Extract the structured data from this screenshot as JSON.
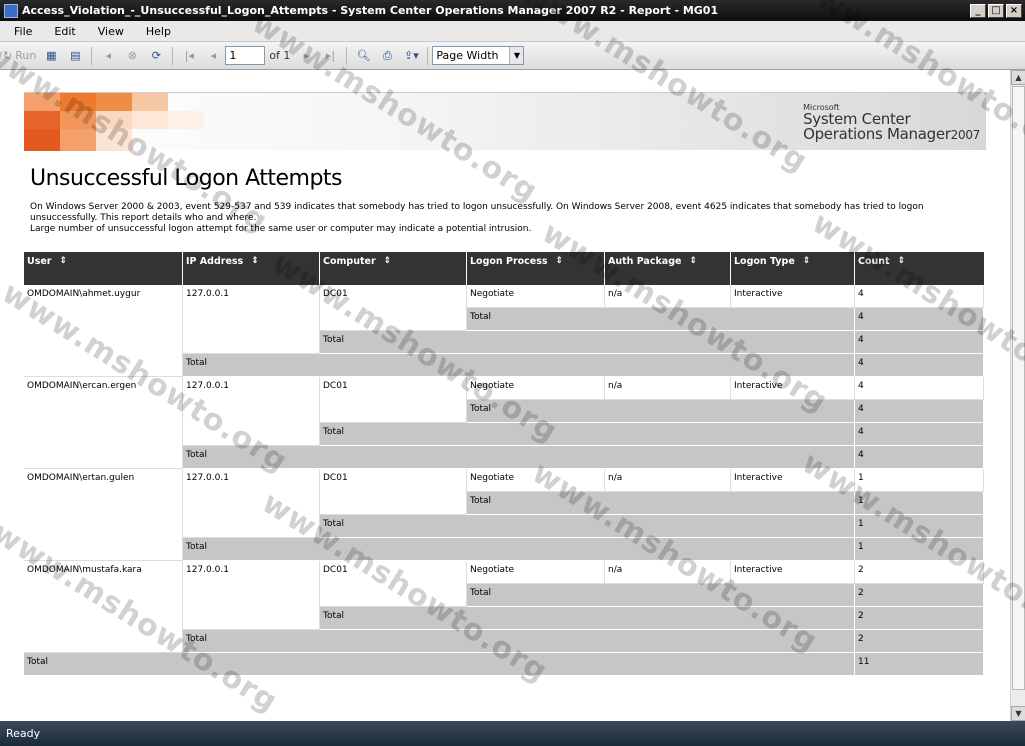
{
  "window": {
    "title": "Access_Violation_-_Unsuccessful_Logon_Attempts - System Center Operations Manager 2007 R2 - Report - MG01"
  },
  "menu": [
    "File",
    "Edit",
    "View",
    "Help"
  ],
  "toolbar": {
    "run_label": "Run",
    "page_value": "1",
    "of_label": "of 1",
    "zoom_value": "Page Width"
  },
  "banner": {
    "microsoft": "Microsoft",
    "line1": "System Center",
    "line2": "Operations Manager",
    "year": "2007"
  },
  "report": {
    "title": "Unsuccessful Logon Attempts",
    "desc1": "On Windows Server 2000 & 2003, event 529-537 and 539 indicates that somebody has tried to logon unsucessfully. On Windows Server 2008, event 4625 indicates that somebody has tried to logon unsuccessfully. This report details who and where.",
    "desc2": "Large number of unsuccessful logon attempt for the same user or computer may indicate a potential intrusion.",
    "columns": [
      "User",
      "IP Address",
      "Computer",
      "Logon Process",
      "Auth Package",
      "Logon Type",
      "Count"
    ],
    "total_label": "Total",
    "groups": [
      {
        "user": "OMDOMAIN\\ahmet.uygur",
        "ip": "127.0.0.1",
        "computer": "DC01",
        "process": "Negotiate",
        "auth": "n/a",
        "type": "Interactive",
        "count": "4",
        "proc_total": "4",
        "comp_total": "4",
        "ip_total": "4"
      },
      {
        "user": "OMDOMAIN\\ercan.ergen",
        "ip": "127.0.0.1",
        "computer": "DC01",
        "process": "Negotiate",
        "auth": "n/a",
        "type": "Interactive",
        "count": "4",
        "proc_total": "4",
        "comp_total": "4",
        "ip_total": "4"
      },
      {
        "user": "OMDOMAIN\\ertan.gulen",
        "ip": "127.0.0.1",
        "computer": "DC01",
        "process": "Negotiate",
        "auth": "n/a",
        "type": "Interactive",
        "count": "1",
        "proc_total": "1",
        "comp_total": "1",
        "ip_total": "1"
      },
      {
        "user": "OMDOMAIN\\mustafa.kara",
        "ip": "127.0.0.1",
        "computer": "DC01",
        "process": "Negotiate",
        "auth": "n/a",
        "type": "Interactive",
        "count": "2",
        "proc_total": "2",
        "comp_total": "2",
        "ip_total": "2"
      }
    ],
    "grand_total": "11"
  },
  "watermark_text": "www.mshowto.org",
  "status": "Ready",
  "colors": {
    "header_bg": "#333333",
    "total_bg": "#c7c5c6",
    "title_bar": "#0d0d0d"
  }
}
